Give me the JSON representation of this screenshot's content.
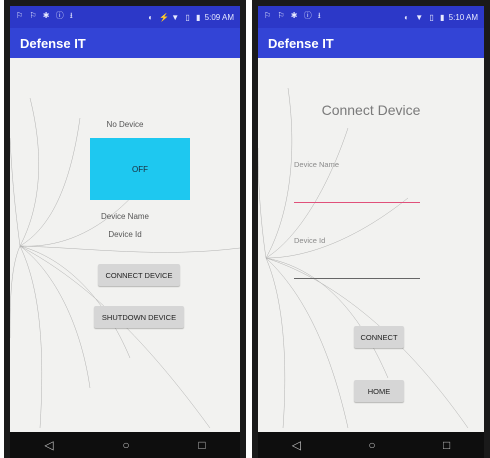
{
  "left_phone": {
    "status": {
      "left_icons": "⚐ ⚐ ✱ ⓘ ⭳",
      "right_icons": "◐ ⚡▼ ▯ ▮",
      "time": "5:09 AM"
    },
    "app_title": "Defense IT",
    "device_status": "No Device",
    "power_state": "OFF",
    "device_name_label": "Device Name",
    "device_id_label": "Device Id",
    "connect_button": "CONNECT DEVICE",
    "shutdown_button": "SHUTDOWN DEVICE",
    "colors": {
      "power_box": "#1ec8f0",
      "app_bar": "#3344d6"
    }
  },
  "right_phone": {
    "status": {
      "left_icons": "⚐ ⚐ ✱ ⓘ ⭳",
      "right_icons": "◐ ▼ ▯ ▮",
      "time": "5:10 AM"
    },
    "app_title": "Defense IT",
    "screen_title": "Connect Device",
    "device_name_label": "Device Name",
    "device_id_label": "Device Id",
    "connect_button": "CONNECT",
    "home_button": "HOME",
    "colors": {
      "active_underline": "#e0507a",
      "inactive_underline": "#666666"
    }
  },
  "navigation": {
    "back": "◁",
    "home": "○",
    "recents": "□"
  }
}
